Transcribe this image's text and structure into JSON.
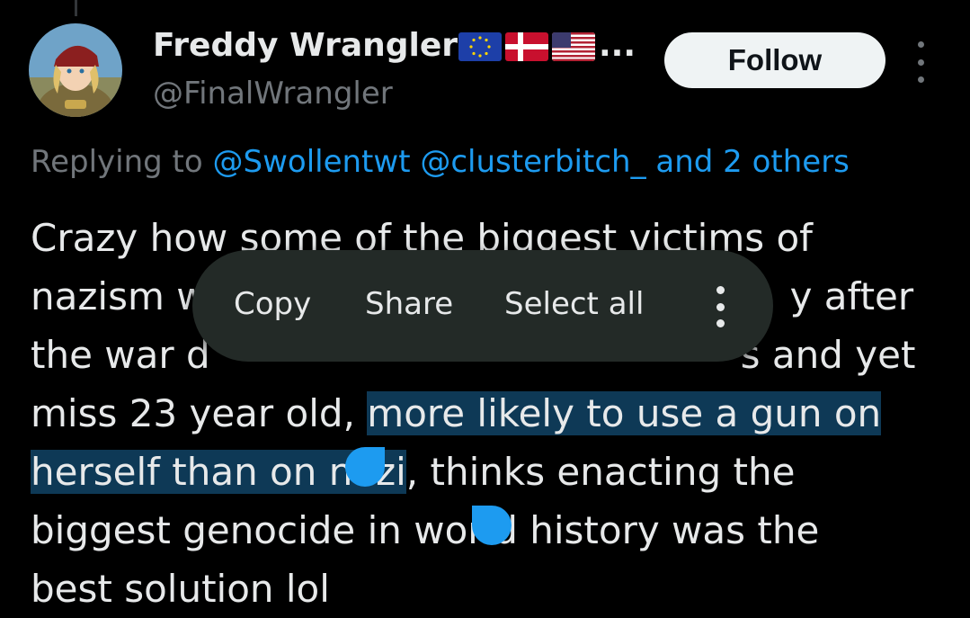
{
  "tweet": {
    "author": {
      "display_name": "Freddy Wrangler",
      "flags": [
        "eu-flag",
        "denmark-flag",
        "usa-flag"
      ],
      "truncation": "...",
      "handle": "@FinalWrangler"
    },
    "follow_label": "Follow",
    "reply": {
      "label": "Replying to",
      "mentions": [
        "@Swollentwt",
        "@clusterbitch_"
      ],
      "others": "and 2 others"
    },
    "body": {
      "line1": "Crazy how some of the biggest victims of",
      "line2_start": "nazism w",
      "line2_end": "y after",
      "line3_start": "the war d",
      "line3_end": "s and yet",
      "line4_plain": "miss 23 year old, ",
      "line4_highlight": "more likely to use a gun on",
      "line5_highlight": "herself than on nazi",
      "line5_plain": ", thinks enacting the",
      "line6": "biggest genocide in world history was the",
      "line7": "best solution lol"
    }
  },
  "context_menu": {
    "copy": "Copy",
    "share": "Share",
    "select_all": "Select all"
  },
  "colors": {
    "background": "#000000",
    "text": "#e7e9ea",
    "muted": "#71767b",
    "accent": "#1d9bf0",
    "selection": "#0e3956",
    "menu_bg": "#232a27"
  }
}
